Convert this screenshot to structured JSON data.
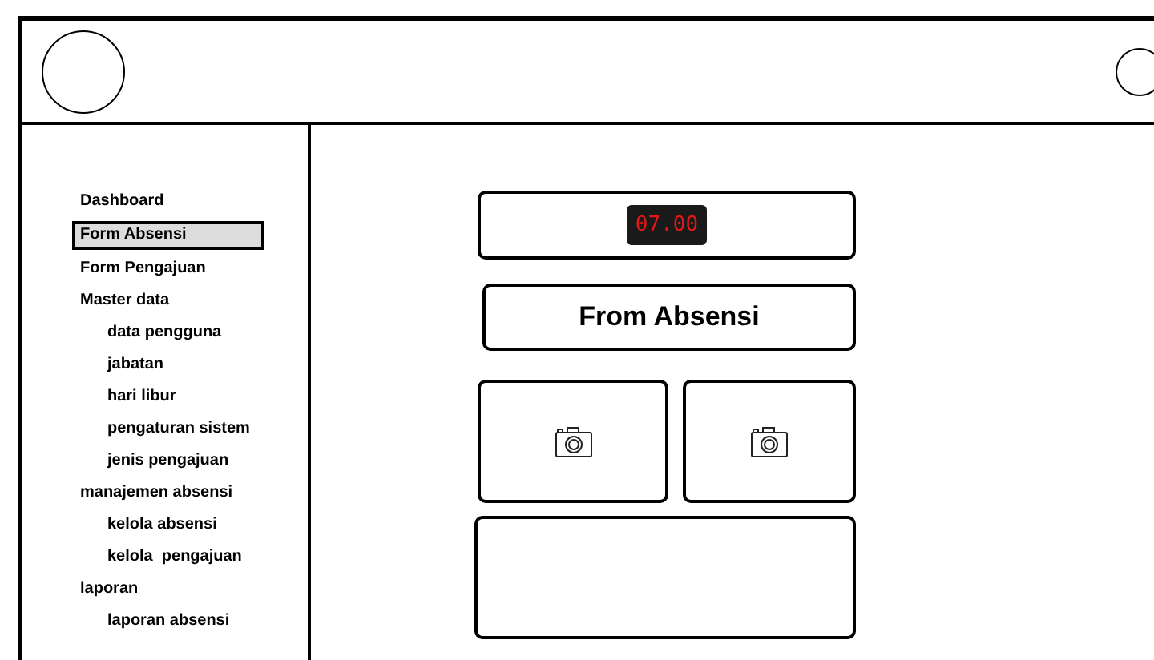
{
  "sidebar": {
    "items": [
      {
        "label": "Dashboard",
        "selected": false
      },
      {
        "label": "Form Absensi",
        "selected": true
      },
      {
        "label": "Form Pengajuan",
        "selected": false
      },
      {
        "label": "Master data",
        "selected": false,
        "children": [
          {
            "label": "data pengguna",
            "selected": false
          },
          {
            "label": "jabatan",
            "selected": false
          },
          {
            "label": "hari libur",
            "selected": false
          },
          {
            "label": "pengaturan sistem",
            "selected": false
          },
          {
            "label": "jenis pengajuan",
            "selected": false
          }
        ]
      },
      {
        "label": "manajemen absensi",
        "selected": false,
        "children": [
          {
            "label": "kelola absensi",
            "selected": false
          },
          {
            "label": "kelola  pengajuan",
            "selected": false
          }
        ]
      },
      {
        "label": "laporan",
        "selected": false,
        "children": [
          {
            "label": "laporan absensi",
            "selected": false
          }
        ]
      }
    ]
  },
  "clock": {
    "time": "07.00"
  },
  "form": {
    "title": "From Absensi"
  }
}
